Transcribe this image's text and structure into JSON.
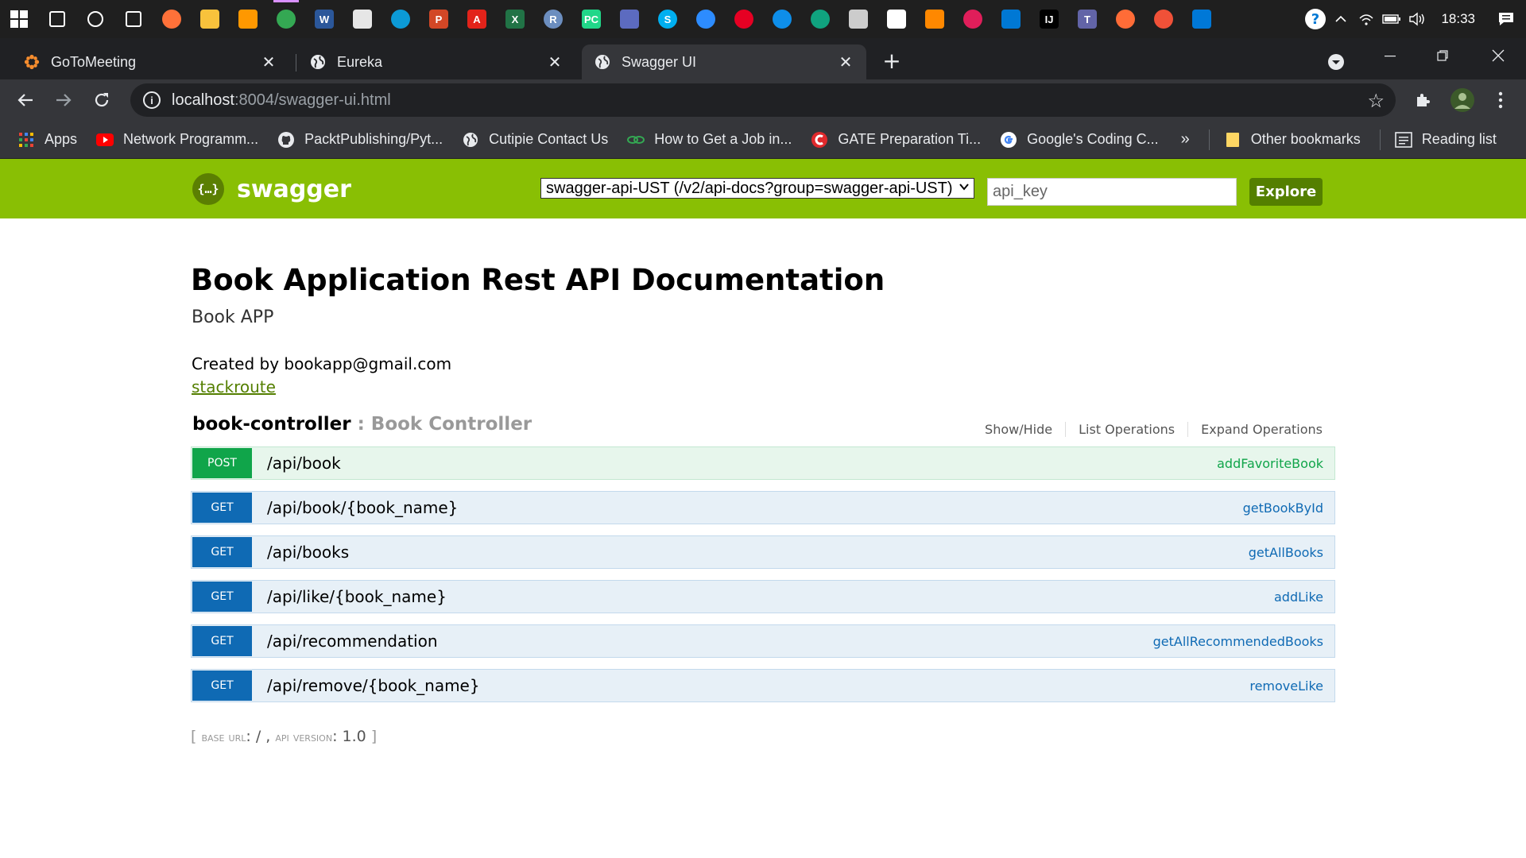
{
  "taskbar": {
    "apps": [
      {
        "name": "search-icon",
        "color": "#1f1f1f"
      },
      {
        "name": "cortana-icon",
        "color": "#1f1f1f"
      },
      {
        "name": "task-view-icon",
        "color": "#1f1f1f"
      },
      {
        "name": "firefox-icon",
        "color": "#ff7139"
      },
      {
        "name": "file-explorer-icon",
        "color": "#f8c23c"
      },
      {
        "name": "sublime-icon",
        "color": "#ff9800"
      },
      {
        "name": "chrome-icon",
        "color": "#34a853"
      },
      {
        "name": "word-icon",
        "color": "#2b579a"
      },
      {
        "name": "store-icon",
        "color": "#e6e6e6"
      },
      {
        "name": "edge-icon",
        "color": "#0c9ad6"
      },
      {
        "name": "powerpoint-icon",
        "color": "#d24726"
      },
      {
        "name": "acrobat-icon",
        "color": "#e2231a"
      },
      {
        "name": "excel-icon",
        "color": "#217346"
      },
      {
        "name": "r-icon",
        "color": "#6c8ebf"
      },
      {
        "name": "pycharm-icon",
        "color": "#21d789"
      },
      {
        "name": "remote-desktop-icon",
        "color": "#5c6bc0"
      },
      {
        "name": "skype-icon",
        "color": "#00aff0"
      },
      {
        "name": "zoom-icon",
        "color": "#2d8cff"
      },
      {
        "name": "pinterest-icon",
        "color": "#e60023"
      },
      {
        "name": "teamviewer-icon",
        "color": "#0e8ee9"
      },
      {
        "name": "chatgpt-icon",
        "color": "#10a37f"
      },
      {
        "name": "git-kraken-icon",
        "color": "#cccccc"
      },
      {
        "name": "virtualbox-icon",
        "color": "#ffffff"
      },
      {
        "name": "vlc-icon",
        "color": "#ff8800"
      },
      {
        "name": "slack-icon",
        "color": "#e01e5a"
      },
      {
        "name": "mail-icon",
        "color": "#0078d4"
      },
      {
        "name": "intellij-icon",
        "color": "#000000"
      },
      {
        "name": "teams-icon",
        "color": "#6264a7"
      },
      {
        "name": "postman-icon",
        "color": "#ff6c37"
      },
      {
        "name": "swift-icon",
        "color": "#f05138"
      },
      {
        "name": "vscode-icon",
        "color": "#0078d7"
      }
    ],
    "clock": "18:33"
  },
  "tabs": [
    {
      "title": "GoToMeeting",
      "favicon": "gotomeeting-icon"
    },
    {
      "title": "Eureka",
      "favicon": "globe-icon"
    },
    {
      "title": "Swagger UI",
      "favicon": "globe-icon"
    }
  ],
  "omnibox": {
    "host": "localhost",
    "path": ":8004/swagger-ui.html"
  },
  "bookmarks": [
    {
      "label": "Apps",
      "icon": "apps-grid-icon"
    },
    {
      "label": "Network Programm...",
      "icon": "youtube-icon"
    },
    {
      "label": "PacktPublishing/Pyt...",
      "icon": "github-icon"
    },
    {
      "label": "Cutipie Contact Us",
      "icon": "globe-icon"
    },
    {
      "label": "How to Get a Job in...",
      "icon": "link-icon"
    },
    {
      "label": "GATE Preparation Ti...",
      "icon": "gate-icon"
    },
    {
      "label": "Google's Coding C...",
      "icon": "google-icon"
    }
  ],
  "bookmarks_more": "»",
  "other_bookmarks": "Other bookmarks",
  "reading_list": "Reading list",
  "swagger": {
    "brand": "swagger",
    "logo_glyph": "{…}",
    "selected_group": "swagger-api-UST (/v2/api-docs?group=swagger-api-UST)",
    "api_key_placeholder": "api_key",
    "explore_label": "Explore"
  },
  "api": {
    "title": "Book Application Rest API Documentation",
    "description": "Book APP",
    "created_by": "Created by bookapp@gmail.com",
    "link": "stackroute"
  },
  "controller": {
    "name": "book-controller",
    "separator": " : ",
    "description": "Book Controller",
    "actions": [
      "Show/Hide",
      "List Operations",
      "Expand Operations"
    ]
  },
  "operations": [
    {
      "method": "POST",
      "path": "/api/book",
      "nickname": "addFavoriteBook"
    },
    {
      "method": "GET",
      "path": "/api/book/{book_name}",
      "nickname": "getBookById"
    },
    {
      "method": "GET",
      "path": "/api/books",
      "nickname": "getAllBooks"
    },
    {
      "method": "GET",
      "path": "/api/like/{book_name}",
      "nickname": "addLike"
    },
    {
      "method": "GET",
      "path": "/api/recommendation",
      "nickname": "getAllRecommendedBooks"
    },
    {
      "method": "GET",
      "path": "/api/remove/{book_name}",
      "nickname": "removeLike"
    }
  ],
  "footer": {
    "open": "[ ",
    "base_url_label": "base url",
    "base_url": ": / , ",
    "api_version_label": "api version",
    "api_version": ": 1.0",
    "close": " ]"
  }
}
